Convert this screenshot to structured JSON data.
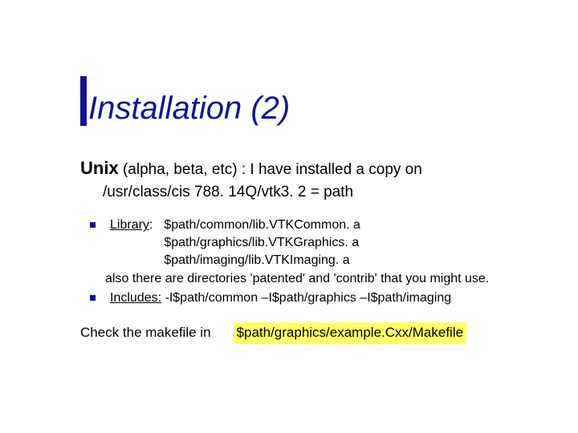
{
  "title": "Installation (2)",
  "lead": {
    "os": "Unix",
    "rest": " (alpha, beta, etc) : I have installed a copy on",
    "path": "/usr/class/cis 788. 14Q/vtk3. 2 = path"
  },
  "library": {
    "label": "Library",
    "colon": ": ",
    "lines": [
      "$path/common/lib.VTKCommon. a",
      "$path/graphics/lib.VTKGraphics. a",
      "$path/imaging/lib.VTKImaging. a"
    ],
    "note": "also there are directories  'patented' and 'contrib' that you might use."
  },
  "includes": {
    "label": "Includes:",
    "value": " -I$path/common –I$path/graphics –I$path/imaging"
  },
  "check": {
    "label": "Check the makefile in",
    "value": "$path/graphics/example.Cxx/Makefile"
  }
}
